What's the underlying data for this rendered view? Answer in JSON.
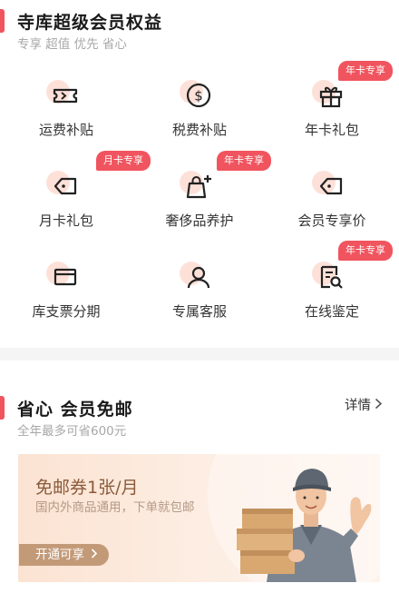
{
  "benefits": {
    "title": "寺库超级会员权益",
    "subtitle": "专享 超值 优先 省心",
    "items": [
      {
        "label": "运费补贴",
        "icon": "coupon-ticket-icon",
        "tag": ""
      },
      {
        "label": "税费补贴",
        "icon": "dollar-circle-icon",
        "tag": ""
      },
      {
        "label": "年卡礼包",
        "icon": "gift-box-icon",
        "tag": "年卡专享"
      },
      {
        "label": "月卡礼包",
        "icon": "price-tag-icon",
        "tag": "月卡专享"
      },
      {
        "label": "奢侈品养护",
        "icon": "handbag-care-icon",
        "tag": "年卡专享"
      },
      {
        "label": "会员专享价",
        "icon": "price-tag-icon",
        "tag": ""
      },
      {
        "label": "库支票分期",
        "icon": "card-icon",
        "tag": ""
      },
      {
        "label": "专属客服",
        "icon": "user-service-icon",
        "tag": ""
      },
      {
        "label": "在线鉴定",
        "icon": "document-search-icon",
        "tag": "年卡专享"
      }
    ]
  },
  "shipping": {
    "title": "省心 会员免邮",
    "subtitle": "全年最多可省600元",
    "detail_label": "详情",
    "banner": {
      "title": "免邮券1张/月",
      "desc": "国内外商品通用，下单就包邮",
      "button_label": "开通可享"
    }
  },
  "colors": {
    "accent": "#f0545e",
    "icon_bg": "#fde1d8",
    "banner_bg": "#fbe3d2",
    "banner_button": "#c39a78"
  }
}
